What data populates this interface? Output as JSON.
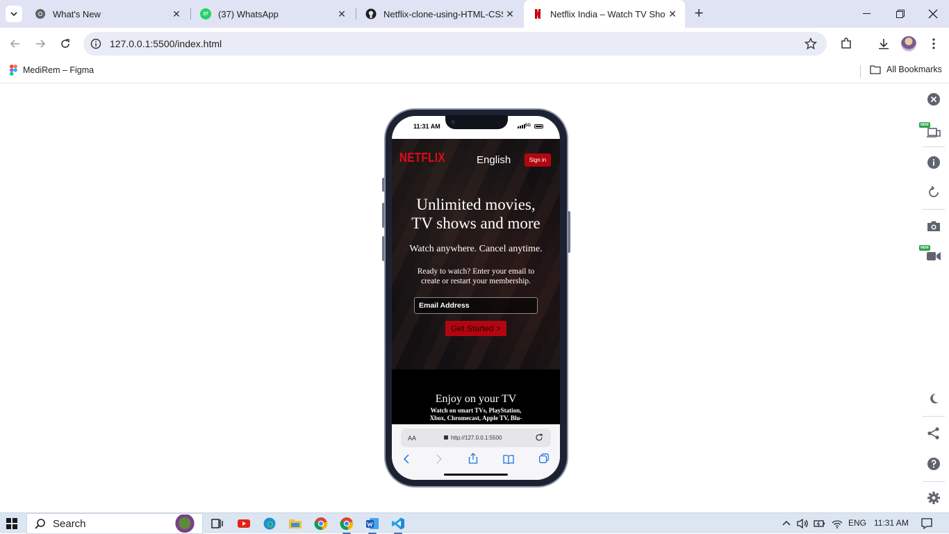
{
  "browser": {
    "tabs": [
      {
        "title": "What's New",
        "icon": "chrome-icon",
        "active": false
      },
      {
        "title": "(37) WhatsApp",
        "icon": "whatsapp-icon",
        "badge": "37",
        "active": false
      },
      {
        "title": "Netflix-clone-using-HTML-CSS/",
        "icon": "github-icon",
        "active": false
      },
      {
        "title": "Netflix India – Watch TV Shows",
        "icon": "netflix-icon",
        "active": true
      }
    ],
    "new_tab_symbol": "+",
    "url": "127.0.0.1:5500/index.html",
    "bookmarks": [
      {
        "label": "MediRem – Figma",
        "icon": "figma-icon"
      }
    ],
    "all_bookmarks_label": "All Bookmarks"
  },
  "side_panel": {
    "new_badge": "NEW"
  },
  "phone": {
    "status_time": "11:31 AM",
    "network": "5G",
    "site": {
      "logo": "NETFLIX",
      "language": "English",
      "signin": "Sign in",
      "headline_line1": "Unlimited movies,",
      "headline_line2": "TV shows and more",
      "subheadline": "Watch anywhere. Cancel anytime.",
      "prompt_line1": "Ready to watch? Enter your email to",
      "prompt_line2": "create or restart your membership.",
      "email_placeholder": "Email Address",
      "cta": "Get Started >",
      "section_title": "Enjoy on your TV",
      "section_text_line1": "Watch on smart TVs, PlayStation,",
      "section_text_line2": "Xbox, Chromecast, Apple TV, Blu-"
    },
    "safari": {
      "text_size_label": "AA",
      "address": "http://127.0.0.1:5500"
    }
  },
  "taskbar": {
    "search_label": "Search",
    "language": "ENG",
    "time": "11:31 AM"
  },
  "colors": {
    "netflix_red": "#e50914",
    "tab_strip": "#dfe3f3",
    "taskbar": "#dce6f2"
  }
}
